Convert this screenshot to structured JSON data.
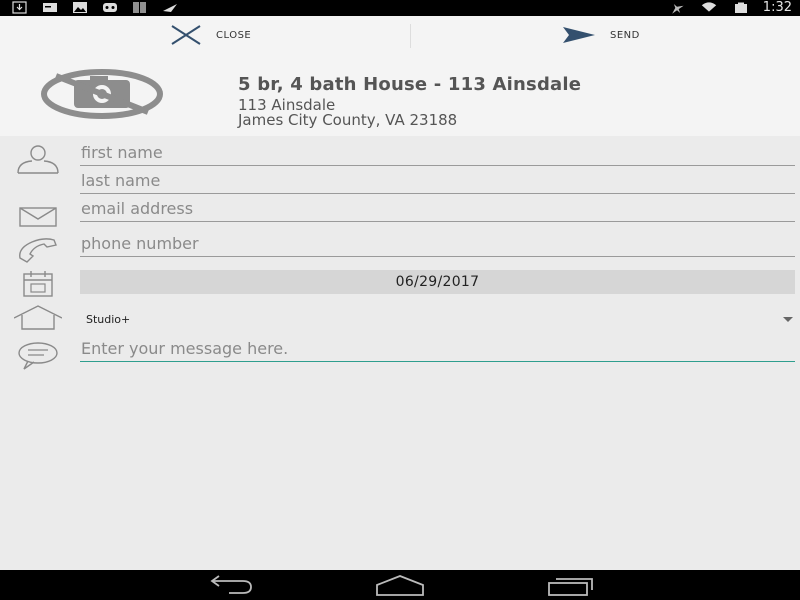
{
  "status_bar": {
    "time": "1:32",
    "left_icons": [
      "download-icon",
      "card-icon",
      "photo-icon",
      "game-controller-icon",
      "barcode-icon",
      "plane-icon"
    ],
    "right_icons": [
      "airplane-mode-icon",
      "wifi-icon",
      "battery-icon"
    ]
  },
  "actions": {
    "close_label": "CLOSE",
    "send_label": "SEND"
  },
  "listing": {
    "title": "5 br, 4 bath House - 113 Ainsdale",
    "address_line1": "113 Ainsdale",
    "address_line2": "James City County, VA 23188"
  },
  "form": {
    "first_name_placeholder": "first name",
    "last_name_placeholder": "last name",
    "email_placeholder": "email address",
    "phone_placeholder": "phone number",
    "date_value": "06/29/2017",
    "property_type_selected": "Studio+",
    "message_placeholder": "Enter your message here."
  },
  "colors": {
    "accent": "#2e9e8e",
    "send_arrow": "#34506e",
    "close_x": "#34506e"
  }
}
